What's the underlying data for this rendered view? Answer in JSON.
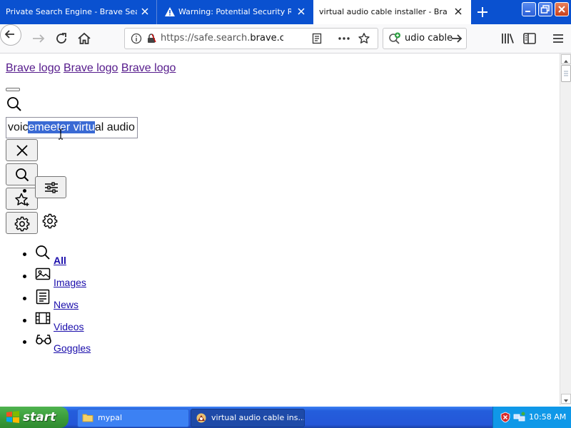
{
  "browser": {
    "tabs": [
      {
        "title": "Private Search Engine - Brave Search",
        "active": false
      },
      {
        "title": "Warning: Potential Security Risk Ahead",
        "active": false
      },
      {
        "title": "virtual audio cable installer - Brave Search",
        "active": true
      }
    ],
    "url_prefix": "https://safe.search.",
    "url_domain": "brave.com",
    "search_box_value": "udio cable"
  },
  "page": {
    "logo_links": [
      "Brave logo",
      "Brave logo",
      "Brave logo"
    ],
    "query": {
      "before": "voic",
      "selected": "emeeter virtu",
      "after": "al audio c"
    },
    "nav": {
      "all": "All",
      "images": "Images",
      "news": "News",
      "videos": "Videos",
      "goggles": "Goggles"
    }
  },
  "icons": {
    "back": "arrow-left-icon",
    "forward": "arrow-right-icon",
    "reload": "reload-icon",
    "home": "home-icon",
    "info": "info-icon",
    "lock": "lock-icon",
    "reader": "reader-view-icon",
    "more": "more-dots-icon",
    "bookmark": "star-icon",
    "library": "library-icon",
    "sidebar": "sidebar-icon",
    "menu": "hamburger-menu-icon",
    "search": "search-icon",
    "clear": "close-icon",
    "ai": "sparkle-star-icon",
    "settings": "gear-icon",
    "images": "image-icon",
    "news": "news-icon",
    "videos": "film-icon",
    "goggles": "glasses-icon",
    "filters": "sliders-icon"
  },
  "taskbar": {
    "start": "start",
    "tasks": [
      "mypal",
      "virtual audio cable ins..."
    ],
    "clock": "10:58 AM"
  },
  "colors": {
    "tabstrip": "#0a51d0",
    "link": "#1a0dab",
    "visited_link": "#551a8b",
    "selection": "#3a6ad4",
    "taskbar": "#245edc",
    "start": "#3b9d3b"
  }
}
